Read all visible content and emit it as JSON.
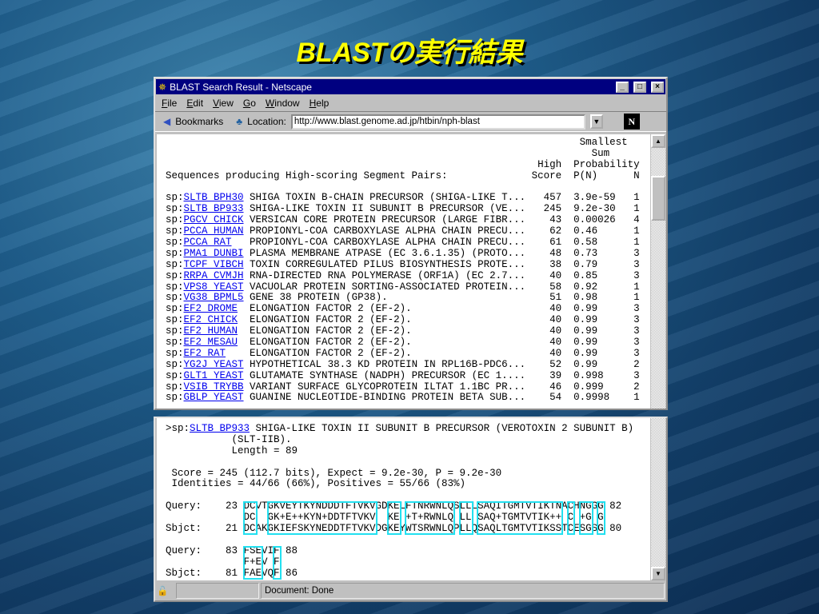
{
  "slide_title": "BLASTの実行結果",
  "window": {
    "title": "BLAST Search Result - Netscape",
    "menu": [
      "File",
      "Edit",
      "View",
      "Go",
      "Window",
      "Help"
    ],
    "bookmarks": "Bookmarks",
    "location_label": "Location:",
    "url": "http://www.blast.genome.ad.jp/htbin/nph-blast",
    "status": "Document: Done"
  },
  "summary": {
    "header": {
      "smallest": "Smallest",
      "sum": "Sum",
      "high": "High",
      "probability": "Probability",
      "sequences": "Sequences producing High-scoring Segment Pairs:",
      "score": "Score",
      "pn": "P(N)",
      "n": "N"
    },
    "rows": [
      {
        "db": "sp:",
        "id": "SLTB_BPH30",
        "desc": "SHIGA TOXIN B-CHAIN PRECURSOR (SHIGA-LIKE T...",
        "score": "457",
        "p": "3.9e-59",
        "n": "1"
      },
      {
        "db": "sp:",
        "id": "SLTB_BP933",
        "desc": "SHIGA-LIKE TOXIN II SUBUNIT B PRECURSOR (VE...",
        "score": "245",
        "p": "9.2e-30",
        "n": "1"
      },
      {
        "db": "sp:",
        "id": "PGCV_CHICK",
        "desc": "VERSICAN CORE PROTEIN PRECURSOR (LARGE FIBR...",
        "score": "43",
        "p": "0.00026",
        "n": "4"
      },
      {
        "db": "sp:",
        "id": "PCCA_HUMAN",
        "desc": "PROPIONYL-COA CARBOXYLASE ALPHA CHAIN PRECU...",
        "score": "62",
        "p": "0.46",
        "n": "1"
      },
      {
        "db": "sp:",
        "id": "PCCA_RAT",
        "desc": "PROPIONYL-COA CARBOXYLASE ALPHA CHAIN PRECU...",
        "score": "61",
        "p": "0.58",
        "n": "1"
      },
      {
        "db": "sp:",
        "id": "PMA1_DUNBI",
        "desc": "PLASMA MEMBRANE ATPASE (EC 3.6.1.35) (PROTO...",
        "score": "48",
        "p": "0.73",
        "n": "3"
      },
      {
        "db": "sp:",
        "id": "TCPF_VIBCH",
        "desc": "TOXIN CORREGULATED PILUS BIOSYNTHESIS PROTE...",
        "score": "38",
        "p": "0.79",
        "n": "3"
      },
      {
        "db": "sp:",
        "id": "RRPA_CVMJH",
        "desc": "RNA-DIRECTED RNA POLYMERASE (ORF1A) (EC 2.7...",
        "score": "40",
        "p": "0.85",
        "n": "3"
      },
      {
        "db": "sp:",
        "id": "VPS8_YEAST",
        "desc": "VACUOLAR PROTEIN SORTING-ASSOCIATED PROTEIN...",
        "score": "58",
        "p": "0.92",
        "n": "1"
      },
      {
        "db": "sp:",
        "id": "VG38_BPML5",
        "desc": "GENE 38 PROTEIN (GP38).",
        "score": "51",
        "p": "0.98",
        "n": "1"
      },
      {
        "db": "sp:",
        "id": "EF2_DROME",
        "desc": "ELONGATION FACTOR 2 (EF-2).",
        "score": "40",
        "p": "0.99",
        "n": "3"
      },
      {
        "db": "sp:",
        "id": "EF2_CHICK",
        "desc": "ELONGATION FACTOR 2 (EF-2).",
        "score": "40",
        "p": "0.99",
        "n": "3"
      },
      {
        "db": "sp:",
        "id": "EF2_HUMAN",
        "desc": "ELONGATION FACTOR 2 (EF-2).",
        "score": "40",
        "p": "0.99",
        "n": "3"
      },
      {
        "db": "sp:",
        "id": "EF2_MESAU",
        "desc": "ELONGATION FACTOR 2 (EF-2).",
        "score": "40",
        "p": "0.99",
        "n": "3"
      },
      {
        "db": "sp:",
        "id": "EF2_RAT",
        "desc": "ELONGATION FACTOR 2 (EF-2).",
        "score": "40",
        "p": "0.99",
        "n": "3"
      },
      {
        "db": "sp:",
        "id": "YG2J_YEAST",
        "desc": "HYPOTHETICAL 38.3 KD PROTEIN IN RPL16B-PDC6...",
        "score": "52",
        "p": "0.99",
        "n": "2"
      },
      {
        "db": "sp:",
        "id": "GLT1_YEAST",
        "desc": "GLUTAMATE SYNTHASE (NADPH) PRECURSOR (EC 1....",
        "score": "39",
        "p": "0.998",
        "n": "3"
      },
      {
        "db": "sp:",
        "id": "VSIB_TRYBB",
        "desc": "VARIANT SURFACE GLYCOPROTEIN ILTAT 1.1BC PR...",
        "score": "46",
        "p": "0.999",
        "n": "2"
      },
      {
        "db": "sp:",
        "id": "GBLP_YEAST",
        "desc": "GUANINE NUCLEOTIDE-BINDING PROTEIN BETA SUB...",
        "score": "54",
        "p": "0.9998",
        "n": "1"
      }
    ]
  },
  "alignment": {
    "prefix": ">sp:",
    "id": "SLTB_BP933",
    "desc": " SHIGA-LIKE TOXIN II SUBUNIT B PRECURSOR (VEROTOXIN 2 SUBUNIT B)",
    "desc2": "           (SLT-IIB).",
    "length": "           Length = 89",
    "score_line": " Score = 245 (112.7 bits), Expect = 9.2e-30, P = 9.2e-30",
    "identity_line": " Identities = 44/66 (66%), Positives = 55/66 (83%)",
    "blocks": [
      {
        "q": "Query:    23 DCVTGKVEYTKYNDDDTFTVKVGDKELFTNRWNLQSLLLSAQITGMTVTIKTNACHNGGG 82",
        "m": "             DC  GK+E++KYN+DDTFTVKV  KE +T+RWNLQ LL SAQ+TGMTVTIK++ C +G G",
        "s": "Sbjct:    21 DCAKGKIEFSKYNEDDTFTVKVDGKEYWTSRWNLQPLLQSAQLTGMTVTIKSSTCESGSG 80"
      },
      {
        "q": "Query:    83 FSEVIF 88",
        "m": "             F+EV F",
        "s": "Sbjct:    81 FAEVQF 86"
      }
    ]
  }
}
